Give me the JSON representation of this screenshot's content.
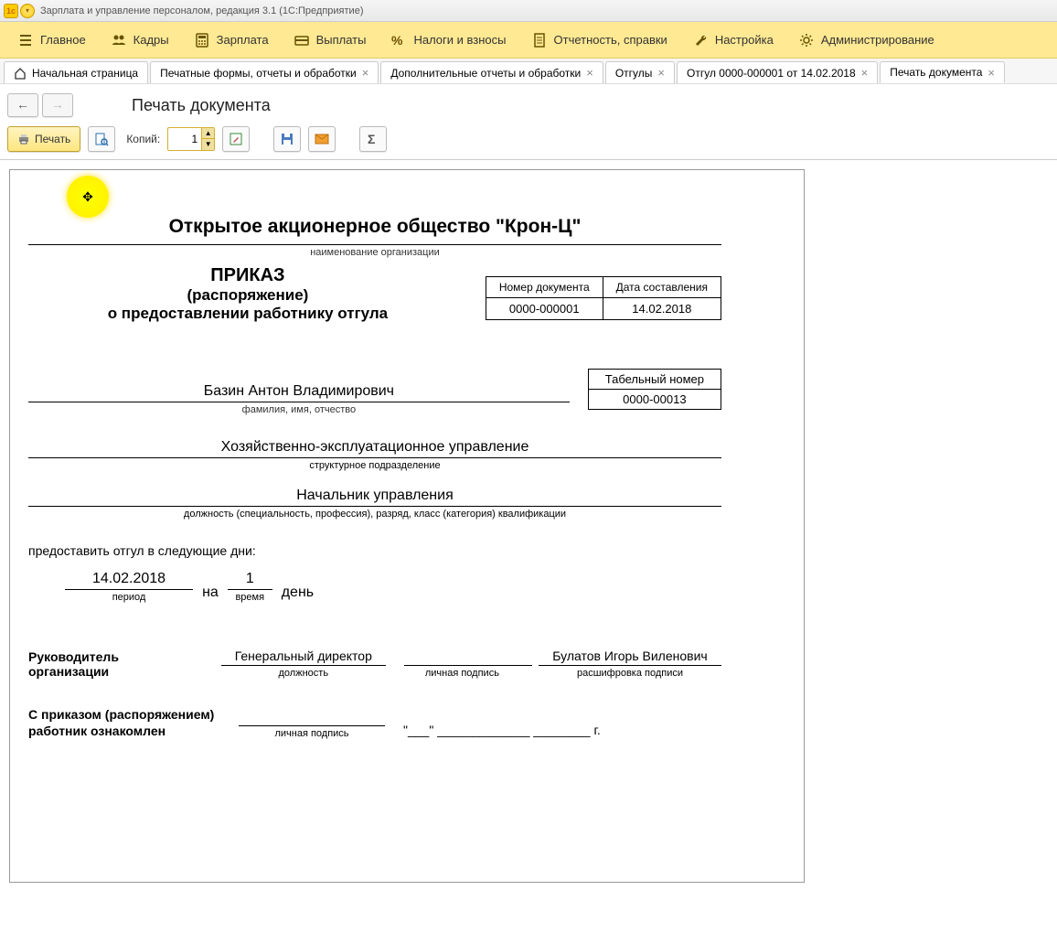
{
  "titlebar": {
    "title": "Зарплата и управление персоналом, редакция 3.1  (1С:Предприятие)"
  },
  "menu": {
    "items": [
      {
        "label": "Главное"
      },
      {
        "label": "Кадры"
      },
      {
        "label": "Зарплата"
      },
      {
        "label": "Выплаты"
      },
      {
        "label": "Налоги и взносы"
      },
      {
        "label": "Отчетность, справки"
      },
      {
        "label": "Настройка"
      },
      {
        "label": "Администрирование"
      }
    ]
  },
  "tabs": [
    {
      "label": "Начальная страница",
      "closable": false,
      "home": true
    },
    {
      "label": "Печатные формы, отчеты и обработки",
      "closable": true
    },
    {
      "label": "Дополнительные отчеты и обработки",
      "closable": true
    },
    {
      "label": "Отгулы",
      "closable": true
    },
    {
      "label": "Отгул 0000-000001 от 14.02.2018",
      "closable": true
    },
    {
      "label": "Печать документа",
      "closable": true,
      "active": true
    }
  ],
  "nav": {
    "page_title": "Печать документа"
  },
  "toolbar": {
    "print_label": "Печать",
    "copies_label": "Копий:",
    "copies_value": "1"
  },
  "doc": {
    "org_name": "Открытое акционерное общество \"Крон-Ц\"",
    "org_caption": "наименование организации",
    "doc_num_hdr": "Номер документа",
    "doc_date_hdr": "Дата составления",
    "doc_num": "0000-000001",
    "doc_date": "14.02.2018",
    "title1": "ПРИКАЗ",
    "title2": "(распоряжение)",
    "title3": "о предоставлении работнику отгула",
    "tab_num_hdr": "Табельный номер",
    "tab_num": "0000-00013",
    "fio": "Базин Антон Владимирович",
    "fio_caption": "фамилия, имя, отчество",
    "dept": "Хозяйственно-эксплуатационное управление",
    "dept_caption": "структурное подразделение",
    "position": "Начальник управления",
    "position_caption": "должность (специальность, профессия), разряд, класс (категория) квалификации",
    "provide_text": "предоставить отгул в следующие дни:",
    "period_val": "14.02.2018",
    "period_caption": "период",
    "na_text": "на",
    "time_val": "1",
    "time_caption": "время",
    "day_text": "день",
    "head_label": "Руководитель организации",
    "head_position": "Генеральный директор",
    "head_position_caption": "должность",
    "sign_caption": "личная подпись",
    "head_name": "Булатов Игорь Виленович",
    "head_name_caption": "расшифровка подписи",
    "ack_label": "С приказом (распоряжением) работник ознакомлен",
    "ack_date": "\"___\" _____________ ________ г."
  }
}
